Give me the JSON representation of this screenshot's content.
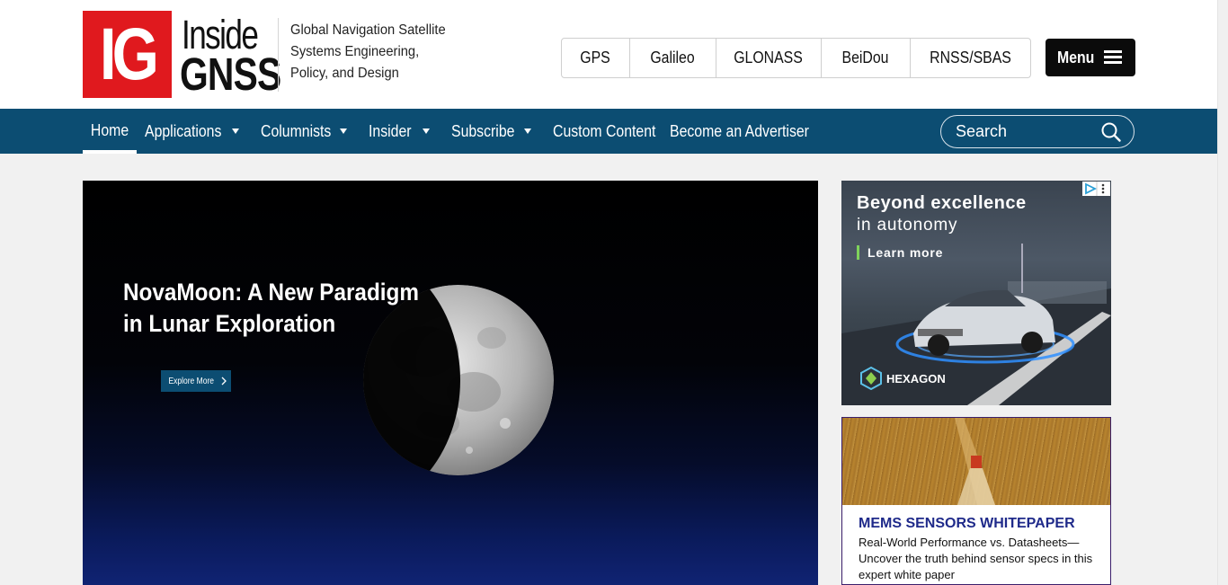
{
  "brand": {
    "logo_mark": "IG",
    "logo_word1": "Inside",
    "logo_word2": "GNSS",
    "tagline": "Global Navigation Satellite Systems Engineering, Policy, and Design",
    "accent_red": "#e0191e"
  },
  "system_tabs": [
    "GPS",
    "Galileo",
    "GLONASS",
    "BeiDou",
    "RNSS/SBAS"
  ],
  "menu_button": {
    "label": "Menu",
    "icon": "hamburger-icon"
  },
  "nav": {
    "color": "#0c4d72",
    "items": [
      {
        "label": "Home",
        "active": true,
        "dropdown": false
      },
      {
        "label": "Applications",
        "dropdown": true
      },
      {
        "label": "Columnists",
        "dropdown": true
      },
      {
        "label": "Insider",
        "dropdown": true
      },
      {
        "label": "Subscribe",
        "dropdown": true
      },
      {
        "label": "Custom Content",
        "dropdown": false
      },
      {
        "label": "Become an Advertiser",
        "dropdown": false
      }
    ]
  },
  "search": {
    "placeholder": "Search",
    "icon": "search-icon"
  },
  "hero": {
    "title": "NovaMoon: A New Paradigm in Lunar Exploration",
    "button_label": "Explore More",
    "button_icon": "chevron-right-icon"
  },
  "ads": {
    "hexagon": {
      "headline": "Beyond excellence",
      "subline": "in autonomy",
      "cta": "Learn more",
      "brand": "HEXAGON"
    },
    "mems": {
      "title": "MEMS SENSORS WHITEPAPER",
      "body": "Real-World Performance vs. Datasheets—Uncover the truth behind sensor specs in this expert white paper"
    }
  }
}
